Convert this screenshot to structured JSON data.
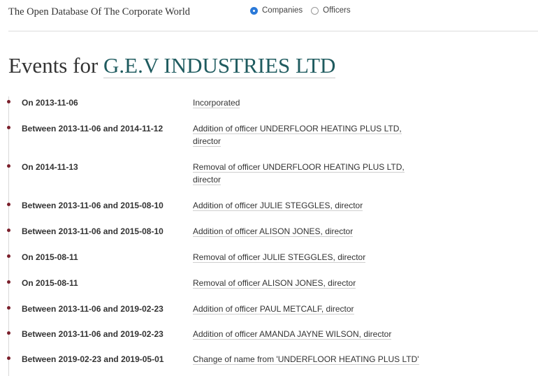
{
  "header": {
    "tagline": "The Open Database Of The Corporate World",
    "search_types": [
      {
        "label": "Companies",
        "selected": true
      },
      {
        "label": "Officers",
        "selected": false
      }
    ]
  },
  "page": {
    "title_prefix": "Events for",
    "company_name": "G.E.V INDUSTRIES LTD"
  },
  "events": [
    {
      "date": "On 2013-11-06",
      "description": "Incorporated"
    },
    {
      "date": "Between 2013-11-06 and 2014-11-12",
      "description": "Addition of officer UNDERFLOOR HEATING PLUS LTD, director"
    },
    {
      "date": "On 2014-11-13",
      "description": "Removal of officer UNDERFLOOR HEATING PLUS LTD, director"
    },
    {
      "date": "Between 2013-11-06 and 2015-08-10",
      "description": "Addition of officer JULIE STEGGLES, director"
    },
    {
      "date": "Between 2013-11-06 and 2015-08-10",
      "description": "Addition of officer ALISON JONES, director"
    },
    {
      "date": "On 2015-08-11",
      "description": "Removal of officer JULIE STEGGLES, director"
    },
    {
      "date": "On 2015-08-11",
      "description": "Removal of officer ALISON JONES, director"
    },
    {
      "date": "Between 2013-11-06 and 2019-02-23",
      "description": "Addition of officer PAUL METCALF, director"
    },
    {
      "date": "Between 2013-11-06 and 2019-02-23",
      "description": "Addition of officer AMANDA JAYNE WILSON, director"
    },
    {
      "date": "Between 2019-02-23 and 2019-05-01",
      "description": "Change of name from 'UNDERFLOOR HEATING PLUS LTD'"
    }
  ],
  "colors": {
    "company_link": "#1f5b5f",
    "timeline_dot": "#7a1f2b",
    "radio_selected": "#2b79d8"
  }
}
